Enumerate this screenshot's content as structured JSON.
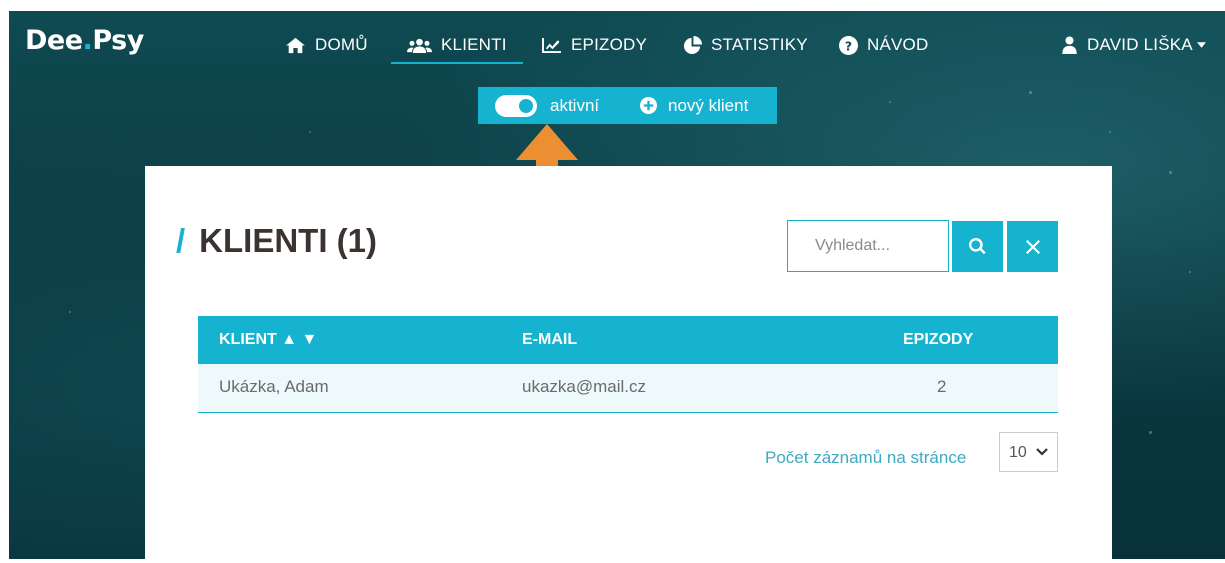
{
  "brand": {
    "logo_text_1": "Dee",
    "logo_text_2": "Psy"
  },
  "nav": {
    "items": [
      {
        "label": "DOMŮ",
        "icon": "home-icon"
      },
      {
        "label": "KLIENTI",
        "icon": "users-icon",
        "active": true
      },
      {
        "label": "EPIZODY",
        "icon": "line-chart-icon"
      },
      {
        "label": "STATISTIKY",
        "icon": "pie-chart-icon"
      },
      {
        "label": "NÁVOD",
        "icon": "question-circle-icon"
      }
    ],
    "user": {
      "label": "DAVID LIŠKA",
      "icon": "user-icon"
    }
  },
  "subbar": {
    "toggle_label": "aktivní",
    "toggle_on": true,
    "new_client_label": "nový klient"
  },
  "page": {
    "title": "KLIENTI (1)",
    "search": {
      "placeholder": "Vyhledat..."
    }
  },
  "table": {
    "headers": [
      "KLIENT ▲ ▼",
      "E-MAIL",
      "EPIZODY"
    ],
    "rows": [
      {
        "client": "Ukázka, Adam",
        "email": "ukazka@mail.cz",
        "episodes": "2"
      }
    ]
  },
  "pagination": {
    "per_page_label": "Počet záznamů na stránce",
    "per_page_value": "10"
  },
  "colors": {
    "accent": "#16b3d1",
    "background": "#0b3a42",
    "title": "#3a3330",
    "annotation_arrow": "#ec8f32"
  }
}
